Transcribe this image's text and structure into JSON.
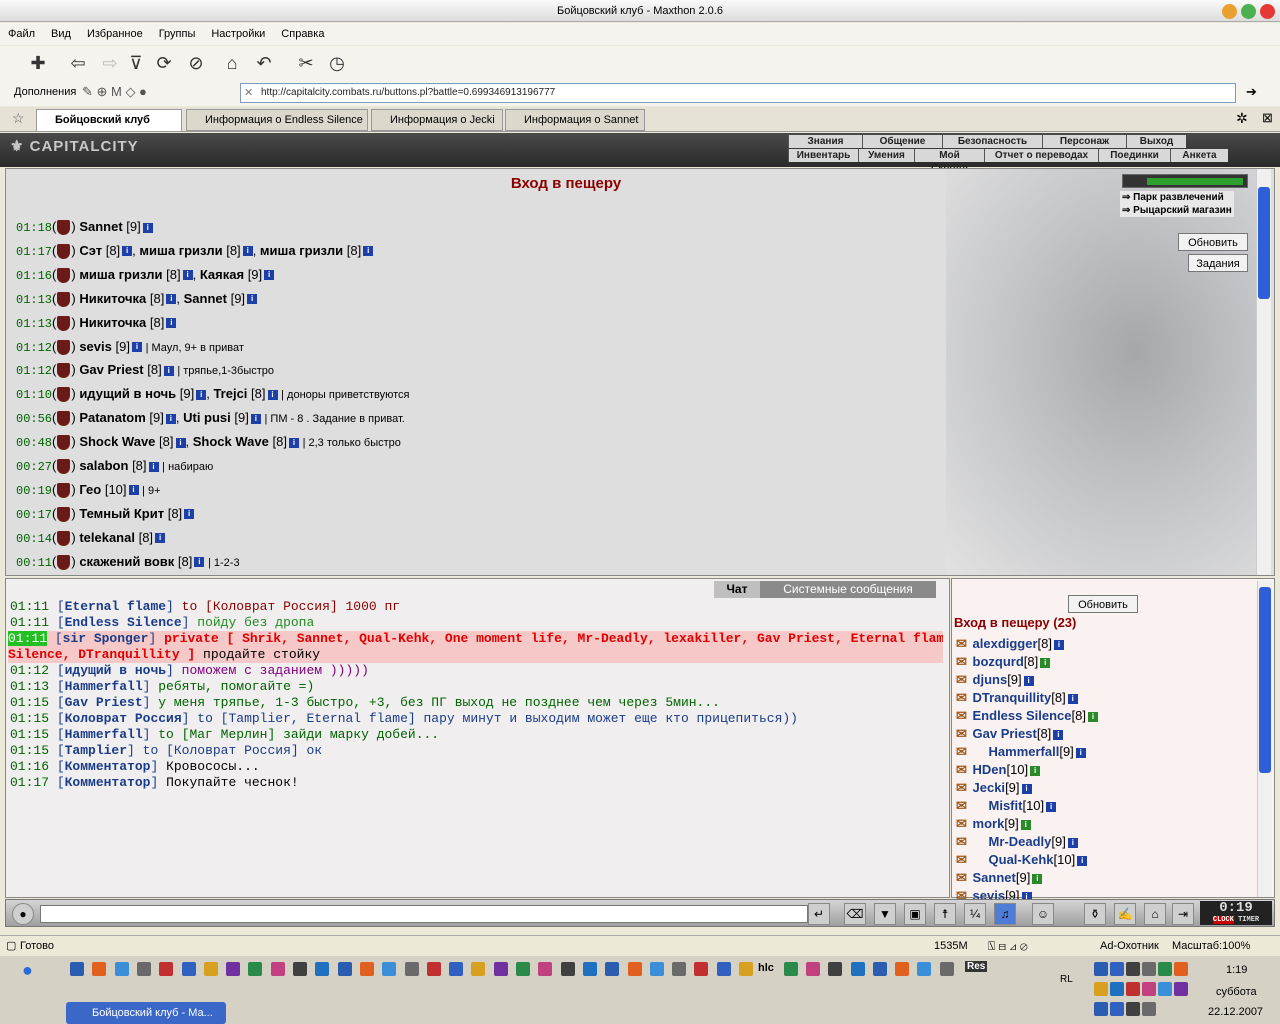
{
  "window": {
    "title": "Бойцовский клуб - Maxthon 2.0.6"
  },
  "menu": [
    "Файл",
    "Вид",
    "Избранное",
    "Группы",
    "Настройки",
    "Справка"
  ],
  "addons_label": "Дополнения",
  "address": "http://capitalcity.combats.ru/buttons.pl?battle=0.699346913196777",
  "tabs": [
    "Бойцовский клуб",
    "Информация о Endless Silence",
    "Информация о Jecki",
    "Информация о Sannet"
  ],
  "game": {
    "logo": "CAPITALCITY",
    "nav_top": [
      "Знания",
      "Общение",
      "Безопасность",
      "Персонаж",
      "Выход"
    ],
    "nav_bottom": [
      "Инвентарь",
      "Умения",
      "Мой Скролл",
      "Отчет о переводах",
      "Поединки",
      "Анкета"
    ]
  },
  "main": {
    "title": "Вход в пещеру",
    "links": [
      "Парк развлечений",
      "Рыцарский магазин"
    ],
    "refresh_button": "Обновить",
    "tasks_button": "Задания",
    "groups": [
      {
        "time": "01:18",
        "members": [
          {
            "name": "Sannet",
            "level": "[9]"
          }
        ],
        "note": ""
      },
      {
        "time": "01:17",
        "members": [
          {
            "name": "Сэт",
            "level": "[8]"
          },
          {
            "name": "миша гризли",
            "level": "[8]"
          },
          {
            "name": "миша гризли",
            "level": "[8]"
          }
        ],
        "note": ""
      },
      {
        "time": "01:16",
        "members": [
          {
            "name": "миша гризли",
            "level": "[8]"
          },
          {
            "name": "Каякая",
            "level": "[9]"
          }
        ],
        "note": ""
      },
      {
        "time": "01:13",
        "members": [
          {
            "name": "Никиточка",
            "level": "[8]"
          },
          {
            "name": "Sannet",
            "level": "[9]"
          }
        ],
        "note": ""
      },
      {
        "time": "01:13",
        "members": [
          {
            "name": "Никиточка",
            "level": "[8]"
          }
        ],
        "note": ""
      },
      {
        "time": "01:12",
        "members": [
          {
            "name": "sevis",
            "level": "[9]"
          }
        ],
        "note": "| Маул, 9+ в приват"
      },
      {
        "time": "01:12",
        "members": [
          {
            "name": "Gav Priest",
            "level": "[8]"
          }
        ],
        "note": "| тряпье,1-3быстро"
      },
      {
        "time": "01:10",
        "members": [
          {
            "name": "идущий в ночь",
            "level": "[9]"
          },
          {
            "name": "Trejci",
            "level": "[8]"
          }
        ],
        "note": "| доноры приветствуются"
      },
      {
        "time": "00:56",
        "members": [
          {
            "name": "Patanatom",
            "level": "[9]"
          },
          {
            "name": "Uti pusi",
            "level": "[9]"
          }
        ],
        "note": "| ПМ - 8 . Задание в приват."
      },
      {
        "time": "00:48",
        "members": [
          {
            "name": "Shock Wave",
            "level": "[8]"
          },
          {
            "name": "Shock Wave",
            "level": "[8]"
          }
        ],
        "note": "| 2,3 только быстро"
      },
      {
        "time": "00:27",
        "members": [
          {
            "name": "salabon",
            "level": "[8]"
          }
        ],
        "note": "| набираю"
      },
      {
        "time": "00:19",
        "members": [
          {
            "name": "Гео",
            "level": "[10]"
          }
        ],
        "note": "| 9+"
      },
      {
        "time": "00:17",
        "members": [
          {
            "name": "Темный Крит",
            "level": "[8]"
          }
        ],
        "note": ""
      },
      {
        "time": "00:14",
        "members": [
          {
            "name": "telekanal",
            "level": "[8]"
          }
        ],
        "note": ""
      },
      {
        "time": "00:11",
        "members": [
          {
            "name": "скажений вовк",
            "level": "[8]"
          }
        ],
        "note": "| 1-2-3"
      }
    ]
  },
  "chat": {
    "tabs": [
      "Чат",
      "Системные сообщения"
    ],
    "lines": [
      {
        "time": "01:11",
        "name": "Eternal flame",
        "rest": " to [Коловрат Россия] 1000 пг",
        "color": "#8b0000"
      },
      {
        "time": "01:11",
        "name": "Endless Silence",
        "rest": " пойду без дропа",
        "color": "#228b22"
      },
      {
        "time": "01:11",
        "name": "sir Sponger",
        "rest": " private [ Shrik, Sannet, Qual-Kehk, One moment life, Mr-Deadly, lexakiller, Gav Priest, Eternal flame, Endless",
        "color": "#e00000"
      },
      {
        "time": "",
        "name": "",
        "rest": "Silence, DTranquillity ]",
        "color": "#e00000",
        "tail": " продайте стойку"
      },
      {
        "time": "01:12",
        "name": "идущий в ночь",
        "rest": " поможем с заданием )))))",
        "color": "#800080"
      },
      {
        "time": "01:13",
        "name": "Hammerfall",
        "rest": " ребяты, помогайте =)",
        "color": "#006400"
      },
      {
        "time": "01:15",
        "name": "Gav Priest",
        "rest": " у меня тряпье, 1-3 быстро, +3, без ПГ выход не позднее чем через 5мин...",
        "color": "#006400"
      },
      {
        "time": "01:15",
        "name": "Коловрат Россия",
        "rest": " to [Tamplier, Eternal flame] пару минут и выходим может еще кто прицепиться))",
        "color": "#1a3d8a"
      },
      {
        "time": "01:15",
        "name": "Hammerfall",
        "rest": " to [Маг Мерлин] зайди марку добей...",
        "color": "#006400"
      },
      {
        "time": "01:15",
        "name": "Tamplier",
        "rest": " to [Коловрат Россия] ок",
        "color": "#1a3d8a"
      },
      {
        "time": "01:16",
        "name": "Комментатор",
        "rest": " Кровососы...",
        "color": "#000000"
      },
      {
        "time": "01:17",
        "name": "Комментатор",
        "rest": " Покупайте чеснок!",
        "color": "#000000"
      }
    ]
  },
  "users": {
    "refresh": "Обновить",
    "title": "Вход в пещеру (23)",
    "list": [
      {
        "name": "alexdigger",
        "level": "[8]"
      },
      {
        "name": "bozqurd",
        "level": "[8]"
      },
      {
        "name": "djuns",
        "level": "[9]"
      },
      {
        "name": "DTranquillity",
        "level": "[8]"
      },
      {
        "name": "Endless Silence",
        "level": "[8]"
      },
      {
        "name": "Gav Priest",
        "level": "[8]"
      },
      {
        "name": "Hammerfall",
        "level": "[9]"
      },
      {
        "name": "HDen",
        "level": "[10]"
      },
      {
        "name": "Jecki",
        "level": "[9]"
      },
      {
        "name": "Misfit",
        "level": "[10]"
      },
      {
        "name": "mork",
        "level": "[9]"
      },
      {
        "name": "Mr-Deadly",
        "level": "[9]"
      },
      {
        "name": "Qual-Kehk",
        "level": "[10]"
      },
      {
        "name": "Sannet",
        "level": "[9]"
      },
      {
        "name": "sevis",
        "level": "[9]"
      }
    ]
  },
  "status": {
    "left": "Готово",
    "mem": "1535M",
    "hunter": "Ad-Охотник",
    "zoom": "Масштаб:100%"
  },
  "clock": {
    "time": "0:19",
    "label1": "CLOCK",
    "label2": "TIMER"
  },
  "taskbar": {
    "task": "Бойцовский клуб - Ма...",
    "lang": "RL",
    "time": "1:19",
    "day": "суббота",
    "date": "22.12.2007",
    "hlc": "hlc",
    "res": "Res"
  }
}
